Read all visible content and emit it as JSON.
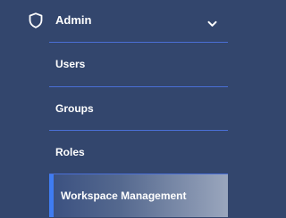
{
  "nav": {
    "section": {
      "label": "Admin",
      "icon": "shield-icon",
      "toggle_icon": "chevron-down-icon",
      "expanded": true
    },
    "items": [
      {
        "label": "Users",
        "active": false
      },
      {
        "label": "Groups",
        "active": false
      },
      {
        "label": "Roles",
        "active": false
      },
      {
        "label": "Workspace Management",
        "active": true
      }
    ]
  },
  "colors": {
    "background": "#33466d",
    "divider": "#4a6fd6",
    "active_bar": "#3f7cf2",
    "text": "#ffffff"
  }
}
